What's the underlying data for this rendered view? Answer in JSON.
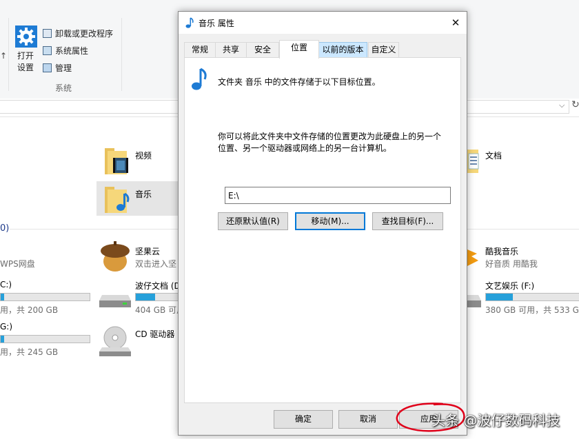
{
  "ribbon": {
    "open_settings_label": "打开\n设置",
    "uninstall_label": "卸载或更改程序",
    "system_props_label": "系统属性",
    "manage_label": "管理",
    "group_label": "系统"
  },
  "folders": {
    "video": "视频",
    "music": "音乐",
    "documents": "文档"
  },
  "section_count": "0)",
  "devices": {
    "wps": "WPS网盘",
    "jianguoyun_name": "坚果云",
    "jianguoyun_sub": "双击进入坚",
    "kugou_name": "酷我音乐",
    "kugou_sub": "好音质 用酷我",
    "c_label": "C:)",
    "c_stats": "用，共 200 GB",
    "c_fill": 0.04,
    "d_name": "波仔文档 (D",
    "d_stats": "404 GB 可用，",
    "d_fill": 0.45,
    "f_name": "文艺娱乐 (F:)",
    "f_stats": "380 GB 可用，共 533 GB",
    "f_fill": 0.29,
    "g_label": "G:)",
    "g_stats": "用，共 245 GB",
    "g_fill": 0.04,
    "cd_name": "CD 驱动器"
  },
  "dialog": {
    "title": "音乐 属性",
    "close_glyph": "✕",
    "tabs": [
      "常规",
      "共享",
      "安全",
      "位置",
      "以前的版本",
      "自定义"
    ],
    "active_tab": "位置",
    "location_heading": "文件夹 音乐 中的文件存储于以下目标位置。",
    "description": "你可以将此文件夹中文件存储的位置更改为此硬盘上的另一个\n位置、另一个驱动器或网络上的另一台计算机。",
    "path_value": "E:\\",
    "restore_default": "还原默认值(R)",
    "move": "移动(M)...",
    "find_target": "查找目标(F)...",
    "ok": "确定",
    "cancel": "取消",
    "apply": "应用"
  },
  "watermark": "头条 @波仔数码科技",
  "colors": {
    "accent": "#0078d7",
    "selection": "#cce8ff",
    "drive_fill": "#26a0da",
    "annotation": "#e0001a"
  }
}
